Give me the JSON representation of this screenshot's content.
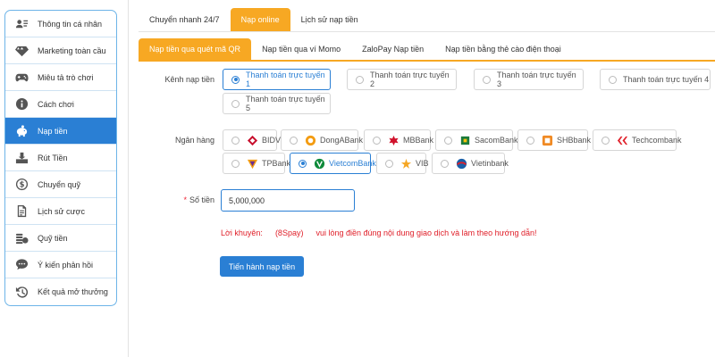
{
  "sidebar": {
    "items": [
      {
        "label": "Thông tin cá nhân",
        "icon": "user-card-icon"
      },
      {
        "label": "Marketing toàn cầu",
        "icon": "diamond-icon"
      },
      {
        "label": "Miêu tả trò chơi",
        "icon": "gamepad-icon"
      },
      {
        "label": "Cách chơi",
        "icon": "info-icon"
      },
      {
        "label": "Nạp tiền",
        "icon": "piggy-bank-icon",
        "active": true
      },
      {
        "label": "Rút Tiền",
        "icon": "withdraw-icon"
      },
      {
        "label": "Chuyển quỹ",
        "icon": "dollar-circle-icon"
      },
      {
        "label": "Lịch sử cược",
        "icon": "document-icon"
      },
      {
        "label": "Quỹ tiền",
        "icon": "coins-icon"
      },
      {
        "label": "Ý kiến phản hồi",
        "icon": "feedback-icon"
      },
      {
        "label": "Kết quả mở thưởng",
        "icon": "history-icon"
      }
    ]
  },
  "top_tabs": [
    "Chuyển nhanh 24/7",
    "Nạp online",
    "Lịch sử nạp tiền"
  ],
  "sub_tabs": [
    "Nạp tiền qua quét mã QR",
    "Nạp tiền qua ví Momo",
    "ZaloPay Nạp tiền",
    "Nạp tiền bằng thẻ cào điện thoại"
  ],
  "form": {
    "channel_label": "Kênh nạp tiền",
    "channels": [
      "Thanh toán trực tuyến 1",
      "Thanh toán trực tuyến 2",
      "Thanh toán trực tuyến 3",
      "Thanh toán trực tuyến 4",
      "Thanh toán trực tuyến 5"
    ],
    "bank_label": "Ngân hàng",
    "banks": [
      "BIDV",
      "DongABank",
      "MBBank",
      "SacomBank",
      "SHBbank",
      "Techcombank",
      "TPBank",
      "VietcomBank",
      "VIB",
      "Vietinbank"
    ],
    "amount_required_mark": "*",
    "amount_label": "Số tiền",
    "amount_value": "5,000,000",
    "advice_prefix": "Lời khuyên:",
    "advice_brand": "(8Spay)",
    "advice_text": "vui lòng điền đúng nội dung giao dịch và làm theo hướng dẫn!",
    "submit_label": "Tiến hành nạp tiền"
  },
  "colors": {
    "accent": "#f7a823",
    "primary": "#2a7fd4",
    "warning": "#e0202a"
  }
}
